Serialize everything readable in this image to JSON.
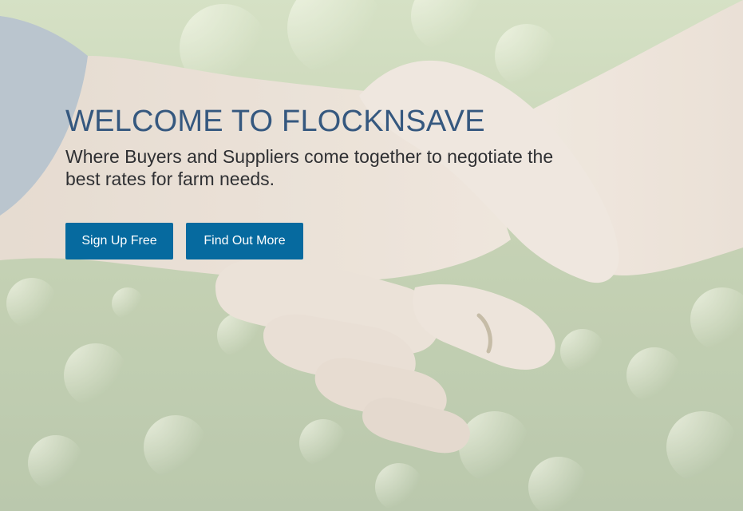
{
  "hero": {
    "title": "WELCOME TO FLOCKNSAVE",
    "subtitle": "Where Buyers and Suppliers come together to negotiate the best rates for farm needs.",
    "background": "handshake-photo",
    "sign_up_label": "Sign Up Free",
    "find_out_label": "Find Out More"
  },
  "colors": {
    "title": "#35587f",
    "subtitle": "#2f3033",
    "button_background": "#066a9f",
    "button_text": "#ffffff"
  }
}
